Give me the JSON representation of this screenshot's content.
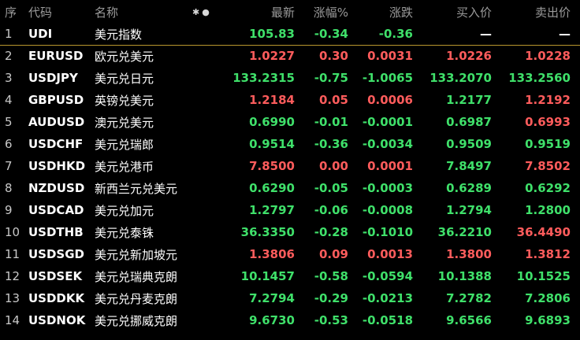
{
  "colors": {
    "background": "#000000",
    "rise": "#ff5c5c",
    "fall": "#3fe06a",
    "divider": "#b8962e",
    "header_text": "#9a9a9a"
  },
  "header": {
    "idx": "序",
    "code": "代码",
    "name": "名称",
    "icons": [
      "asterisk-icon",
      "dot-icon"
    ],
    "last": "最新",
    "pct": "涨幅%",
    "chg": "涨跌",
    "bid": "买入价",
    "ask": "卖出价"
  },
  "rows": [
    {
      "idx": "1",
      "code": "UDI",
      "name": "美元指数",
      "last": "105.83",
      "pct": "-0.34",
      "chg": "-0.36",
      "bid": "—",
      "ask": "—",
      "last_c": "down",
      "pct_c": "down",
      "chg_c": "down",
      "bid_c": "dash",
      "ask_c": "dash"
    },
    {
      "idx": "2",
      "code": "EURUSD",
      "name": "欧元兑美元",
      "last": "1.0227",
      "pct": "0.30",
      "chg": "0.0031",
      "bid": "1.0226",
      "ask": "1.0228",
      "last_c": "up",
      "pct_c": "up",
      "chg_c": "up",
      "bid_c": "up",
      "ask_c": "up"
    },
    {
      "idx": "3",
      "code": "USDJPY",
      "name": "美元兑日元",
      "last": "133.2315",
      "pct": "-0.75",
      "chg": "-1.0065",
      "bid": "133.2070",
      "ask": "133.2560",
      "last_c": "down",
      "pct_c": "down",
      "chg_c": "down",
      "bid_c": "down",
      "ask_c": "down"
    },
    {
      "idx": "4",
      "code": "GBPUSD",
      "name": "英镑兑美元",
      "last": "1.2184",
      "pct": "0.05",
      "chg": "0.0006",
      "bid": "1.2177",
      "ask": "1.2192",
      "last_c": "up",
      "pct_c": "up",
      "chg_c": "up",
      "bid_c": "down",
      "ask_c": "up"
    },
    {
      "idx": "5",
      "code": "AUDUSD",
      "name": "澳元兑美元",
      "last": "0.6990",
      "pct": "-0.01",
      "chg": "-0.0001",
      "bid": "0.6987",
      "ask": "0.6993",
      "last_c": "down",
      "pct_c": "down",
      "chg_c": "down",
      "bid_c": "down",
      "ask_c": "up"
    },
    {
      "idx": "6",
      "code": "USDCHF",
      "name": "美元兑瑞郎",
      "last": "0.9514",
      "pct": "-0.36",
      "chg": "-0.0034",
      "bid": "0.9509",
      "ask": "0.9519",
      "last_c": "down",
      "pct_c": "down",
      "chg_c": "down",
      "bid_c": "down",
      "ask_c": "down"
    },
    {
      "idx": "7",
      "code": "USDHKD",
      "name": "美元兑港币",
      "last": "7.8500",
      "pct": "0.00",
      "chg": "0.0001",
      "bid": "7.8497",
      "ask": "7.8502",
      "last_c": "up",
      "pct_c": "up",
      "chg_c": "up",
      "bid_c": "down",
      "ask_c": "up"
    },
    {
      "idx": "8",
      "code": "NZDUSD",
      "name": "新西兰元兑美元",
      "last": "0.6290",
      "pct": "-0.05",
      "chg": "-0.0003",
      "bid": "0.6289",
      "ask": "0.6292",
      "last_c": "down",
      "pct_c": "down",
      "chg_c": "down",
      "bid_c": "down",
      "ask_c": "down"
    },
    {
      "idx": "9",
      "code": "USDCAD",
      "name": "美元兑加元",
      "last": "1.2797",
      "pct": "-0.06",
      "chg": "-0.0008",
      "bid": "1.2794",
      "ask": "1.2800",
      "last_c": "down",
      "pct_c": "down",
      "chg_c": "down",
      "bid_c": "down",
      "ask_c": "down"
    },
    {
      "idx": "10",
      "code": "USDTHB",
      "name": "美元兑泰铢",
      "last": "36.3350",
      "pct": "-0.28",
      "chg": "-0.1010",
      "bid": "36.2210",
      "ask": "36.4490",
      "last_c": "down",
      "pct_c": "down",
      "chg_c": "down",
      "bid_c": "down",
      "ask_c": "up"
    },
    {
      "idx": "11",
      "code": "USDSGD",
      "name": "美元兑新加坡元",
      "last": "1.3806",
      "pct": "0.09",
      "chg": "0.0013",
      "bid": "1.3800",
      "ask": "1.3812",
      "last_c": "up",
      "pct_c": "up",
      "chg_c": "up",
      "bid_c": "up",
      "ask_c": "up"
    },
    {
      "idx": "12",
      "code": "USDSEK",
      "name": "美元兑瑞典克朗",
      "last": "10.1457",
      "pct": "-0.58",
      "chg": "-0.0594",
      "bid": "10.1388",
      "ask": "10.1525",
      "last_c": "down",
      "pct_c": "down",
      "chg_c": "down",
      "bid_c": "down",
      "ask_c": "down"
    },
    {
      "idx": "13",
      "code": "USDDKK",
      "name": "美元兑丹麦克朗",
      "last": "7.2794",
      "pct": "-0.29",
      "chg": "-0.0213",
      "bid": "7.2782",
      "ask": "7.2806",
      "last_c": "down",
      "pct_c": "down",
      "chg_c": "down",
      "bid_c": "down",
      "ask_c": "down"
    },
    {
      "idx": "14",
      "code": "USDNOK",
      "name": "美元兑挪威克朗",
      "last": "9.6730",
      "pct": "-0.53",
      "chg": "-0.0518",
      "bid": "9.6566",
      "ask": "9.6893",
      "last_c": "down",
      "pct_c": "down",
      "chg_c": "down",
      "bid_c": "down",
      "ask_c": "down"
    }
  ]
}
